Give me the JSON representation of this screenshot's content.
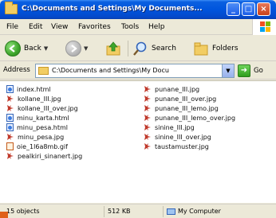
{
  "window": {
    "title": "C:\\Documents and Settings\\My Documents..."
  },
  "titlebar_buttons": {
    "minimize": "_",
    "maximize": "□",
    "close": "×"
  },
  "menu": {
    "items": [
      "File",
      "Edit",
      "View",
      "Favorites",
      "Tools",
      "Help"
    ]
  },
  "toolbar": {
    "back_label": "Back",
    "search_label": "Search",
    "folders_label": "Folders"
  },
  "address": {
    "label": "Address",
    "value": "C:\\Documents and Settings\\My Docu",
    "go_label": "Go"
  },
  "files": {
    "left": [
      {
        "name": "index.html",
        "type": "html"
      },
      {
        "name": "kollane_III.jpg",
        "type": "img"
      },
      {
        "name": "kollane_III_over.jpg",
        "type": "img"
      },
      {
        "name": "minu_karta.html",
        "type": "html"
      },
      {
        "name": "minu_pesa.html",
        "type": "html"
      },
      {
        "name": "minu_pesa.jpg",
        "type": "img"
      },
      {
        "name": "oie_1l6a8mb.gif",
        "type": "gif"
      },
      {
        "name": "pealkiri_sinanert.jpg",
        "type": "img"
      }
    ],
    "right": [
      {
        "name": "punane_III.jpg",
        "type": "img"
      },
      {
        "name": "punane_III_over.jpg",
        "type": "img"
      },
      {
        "name": "punane_III_lemo.jpg",
        "type": "img"
      },
      {
        "name": "punane_III_lemo_over.jpg",
        "type": "img"
      },
      {
        "name": "sinine_III.jpg",
        "type": "img"
      },
      {
        "name": "sinine_III_over.jpg",
        "type": "img"
      },
      {
        "name": "taustamuster.jpg",
        "type": "img"
      }
    ]
  },
  "status": {
    "objects": "15 objects",
    "size": "512 KB",
    "location": "My Computer"
  },
  "colors": {
    "titlebar": "#0055dd",
    "window_bg": "#ece9d8",
    "file_icon_red": "#c0392b",
    "html_icon_blue": "#3a7be0"
  }
}
